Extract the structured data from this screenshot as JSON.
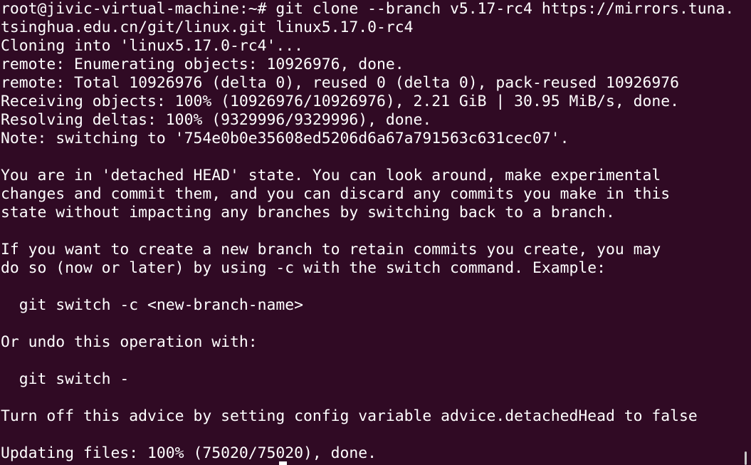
{
  "terminal": {
    "lines": [
      "root@jivic-virtual-machine:~# git clone --branch v5.17-rc4 https://mirrors.tuna.",
      "tsinghua.edu.cn/git/linux.git linux5.17.0-rc4",
      "Cloning into 'linux5.17.0-rc4'...",
      "remote: Enumerating objects: 10926976, done.",
      "remote: Total 10926976 (delta 0), reused 0 (delta 0), pack-reused 10926976",
      "Receiving objects: 100% (10926976/10926976), 2.21 GiB | 30.95 MiB/s, done.",
      "Resolving deltas: 100% (9329996/9329996), done.",
      "Note: switching to '754e0b0e35608ed5206d6a67a791563c631cec07'.",
      "",
      "You are in 'detached HEAD' state. You can look around, make experimental",
      "changes and commit them, and you can discard any commits you make in this",
      "state without impacting any branches by switching back to a branch.",
      "",
      "If you want to create a new branch to retain commits you create, you may",
      "do so (now or later) by using -c with the switch command. Example:",
      "",
      "  git switch -c <new-branch-name>",
      "",
      "Or undo this operation with:",
      "",
      "  git switch -",
      "",
      "Turn off this advice by setting config variable advice.detachedHead to false",
      "",
      "Updating files: 100% (75020/75020), done."
    ]
  },
  "colors": {
    "background": "#300a24",
    "foreground": "#ffffff"
  }
}
